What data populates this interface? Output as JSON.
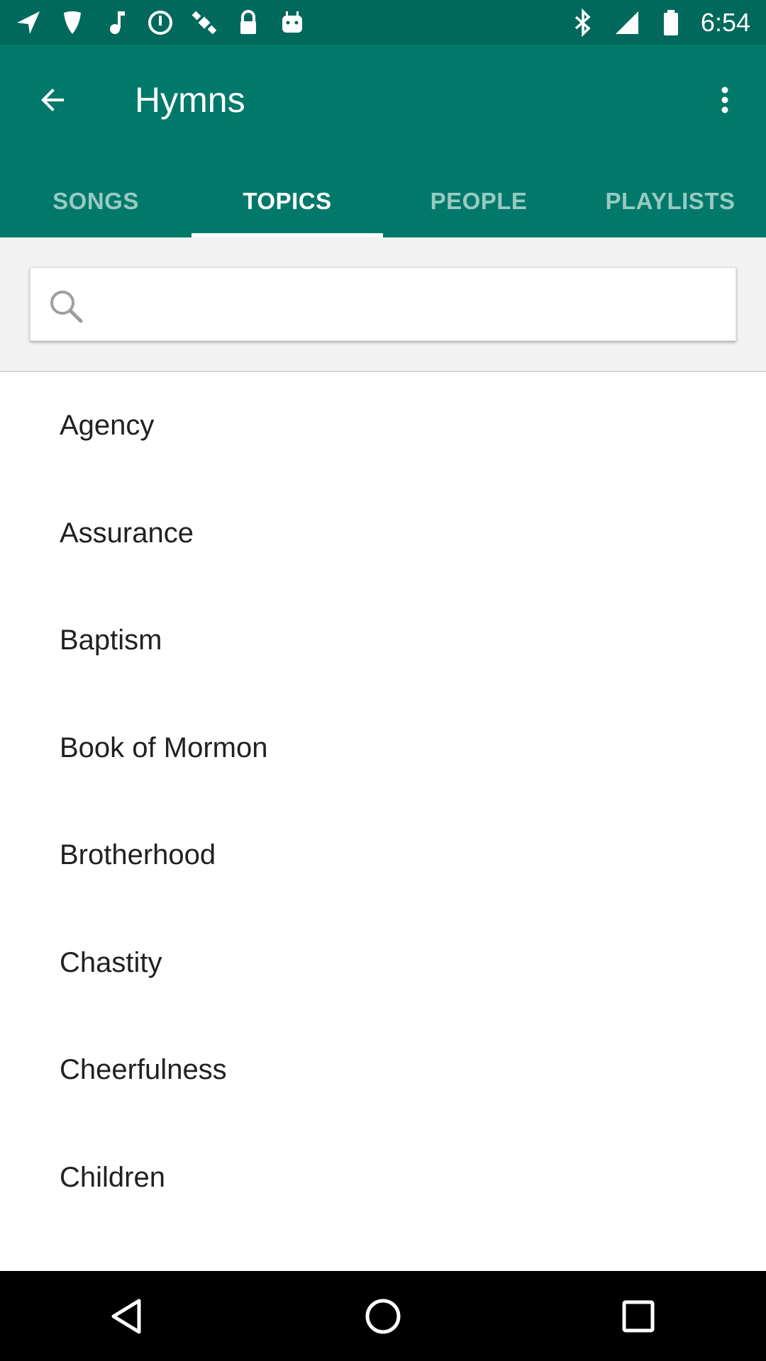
{
  "status_bar": {
    "time": "6:54",
    "left_icons": [
      "navigation-arrow-icon",
      "guitar-pick-icon",
      "music-note-icon",
      "data-saver-icon",
      "satellite-icon",
      "lock-icon",
      "android-icon"
    ],
    "right_icons": [
      "bluetooth-icon",
      "signal-icon",
      "battery-icon"
    ]
  },
  "app_bar": {
    "title": "Hymns",
    "back_icon": "arrow-back-icon",
    "overflow_icon": "more-vert-icon",
    "colors": {
      "status_bar": "#00695c",
      "app_bar": "#00796b"
    }
  },
  "tabs": [
    {
      "label": "SONGS",
      "active": false
    },
    {
      "label": "TOPICS",
      "active": true
    },
    {
      "label": "PEOPLE",
      "active": false
    },
    {
      "label": "PLAYLISTS",
      "active": false
    }
  ],
  "search": {
    "icon": "search-icon",
    "placeholder": "",
    "value": ""
  },
  "topics": [
    "Agency",
    "Assurance",
    "Baptism",
    "Book of Mormon",
    "Brotherhood",
    "Chastity",
    "Cheerfulness",
    "Children"
  ],
  "nav_bar": {
    "icons": [
      "back-triangle-icon",
      "home-circle-icon",
      "recents-square-icon"
    ]
  }
}
